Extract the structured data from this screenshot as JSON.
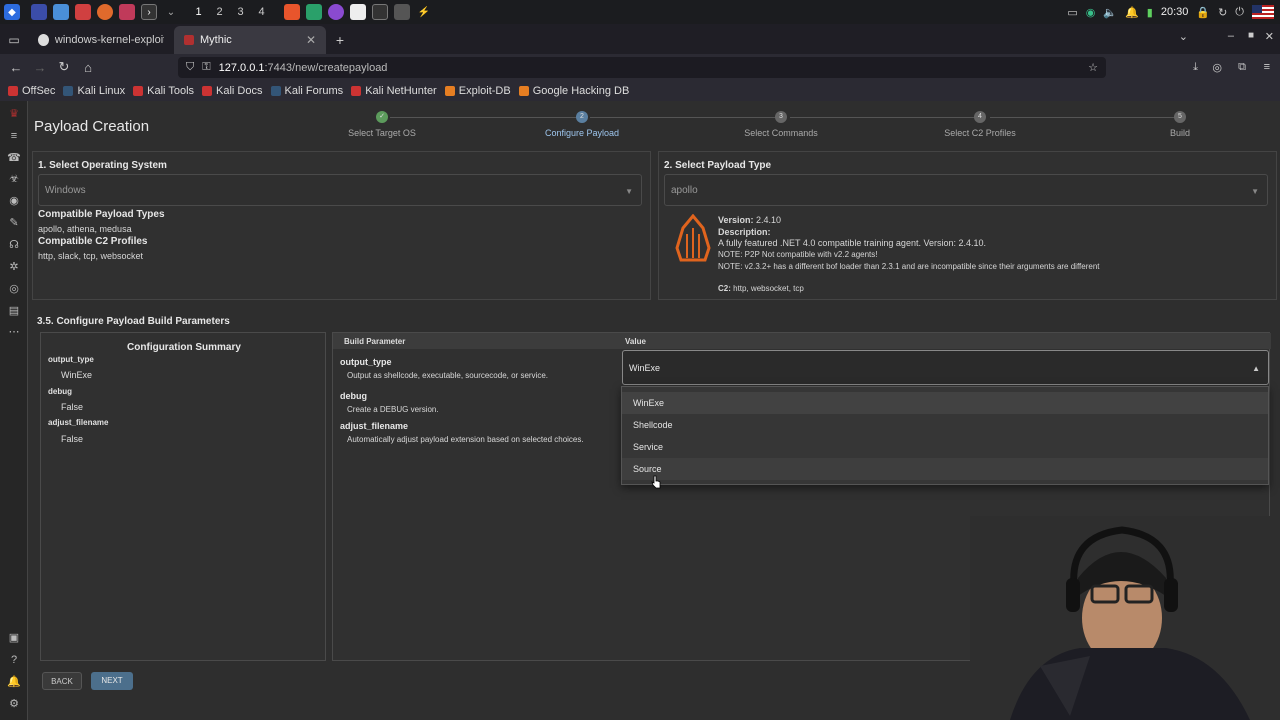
{
  "taskbar": {
    "workspaces": [
      "1",
      "2",
      "3",
      "4"
    ],
    "clock": "20:30"
  },
  "browser": {
    "tabs": [
      {
        "label": "windows-kernel-exploits/",
        "active": false
      },
      {
        "label": "Mythic",
        "active": true
      }
    ],
    "url_host": "127.0.0.1",
    "url_rest": ":7443/new/createpayload",
    "bookmarks": [
      "OffSec",
      "Kali Linux",
      "Kali Tools",
      "Kali Docs",
      "Kali Forums",
      "Kali NetHunter",
      "Exploit-DB",
      "Google Hacking DB"
    ]
  },
  "page": {
    "title": "Payload Creation",
    "steps": [
      {
        "number": "1",
        "label": "Select Target OS",
        "state": "done"
      },
      {
        "number": "2",
        "label": "Configure Payload",
        "state": "active"
      },
      {
        "number": "3",
        "label": "Select Commands",
        "state": "pending"
      },
      {
        "number": "4",
        "label": "Select C2 Profiles",
        "state": "pending"
      },
      {
        "number": "5",
        "label": "Build",
        "state": "pending"
      }
    ]
  },
  "os_panel": {
    "heading": "1. Select Operating System",
    "selected": "Windows",
    "compat_types_label": "Compatible Payload Types",
    "compat_types": "apollo, athena, medusa",
    "compat_c2_label": "Compatible C2 Profiles",
    "compat_c2": "http, slack, tcp, websocket"
  },
  "type_panel": {
    "heading": "2. Select Payload Type",
    "selected": "apollo",
    "version_label": "Version:",
    "version": "2.4.10",
    "description_label": "Description:",
    "description_lines": [
      "A fully featured .NET 4.0 compatible training agent. Version: 2.4.10.",
      "NOTE: P2P Not compatible with v2.2 agents!",
      "NOTE: v2.3.2+ has a different bof loader than 2.3.1 and are incompatible since their arguments are different"
    ],
    "c2_label": "C2:",
    "c2": "http, websocket, tcp"
  },
  "build_params": {
    "section_title": "3.5. Configure Payload Build Parameters",
    "summary_title": "Configuration Summary",
    "summary": [
      {
        "key": "output_type",
        "value": "WinExe"
      },
      {
        "key": "debug",
        "value": "False"
      },
      {
        "key": "adjust_filename",
        "value": "False"
      }
    ],
    "col_param": "Build Parameter",
    "col_value": "Value",
    "rows": [
      {
        "name": "output_type",
        "desc": "Output as shellcode, executable, sourcecode, or service."
      },
      {
        "name": "debug",
        "desc": "Create a DEBUG version."
      },
      {
        "name": "adjust_filename",
        "desc": "Automatically adjust payload extension based on selected choices."
      }
    ],
    "output_type_value": "WinExe",
    "dropdown_options": [
      "WinExe",
      "Shellcode",
      "Service",
      "Source"
    ]
  },
  "buttons": {
    "back": "BACK",
    "next": "NEXT"
  }
}
